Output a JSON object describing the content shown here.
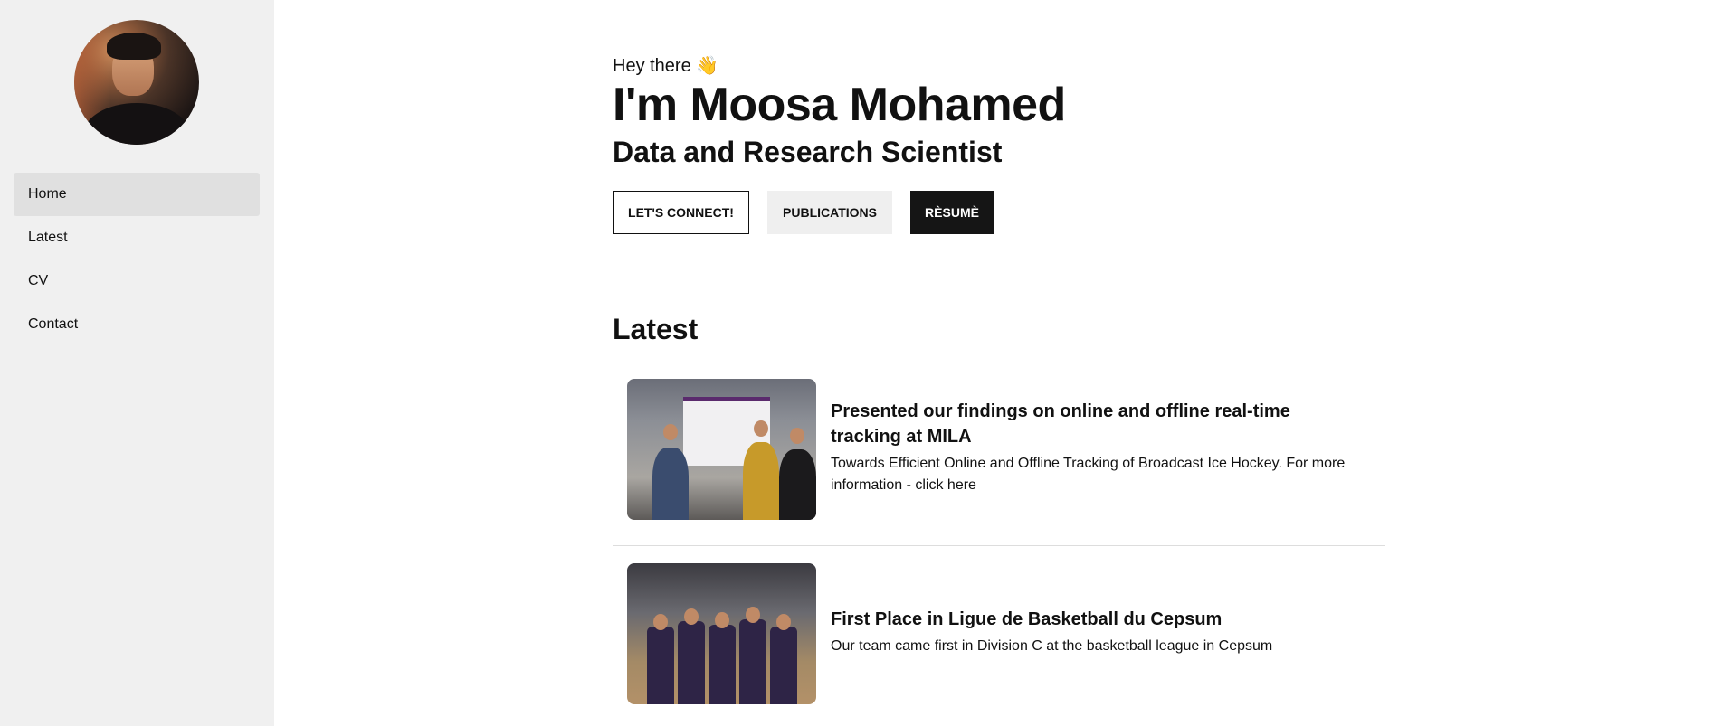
{
  "sidebar": {
    "items": [
      {
        "label": "Home"
      },
      {
        "label": "Latest"
      },
      {
        "label": "CV"
      },
      {
        "label": "Contact"
      }
    ]
  },
  "hero": {
    "greeting": "Hey there 👋",
    "name": "I'm Moosa Mohamed",
    "role": "Data and Research Scientist",
    "buttons": {
      "connect": "LET'S CONNECT!",
      "publications": "PUBLICATIONS",
      "resume": "RÈSUMÈ"
    }
  },
  "latest": {
    "heading": "Latest",
    "posts": [
      {
        "title": "Presented our findings on online and offline real-time tracking at MILA",
        "description": "Towards Efficient Online and Offline Tracking of Broadcast Ice Hockey. For more information - click here"
      },
      {
        "title": "First Place in Ligue de Basketball du Cepsum",
        "description": "Our team came first in Division C at the basketball league in Cepsum"
      }
    ]
  }
}
